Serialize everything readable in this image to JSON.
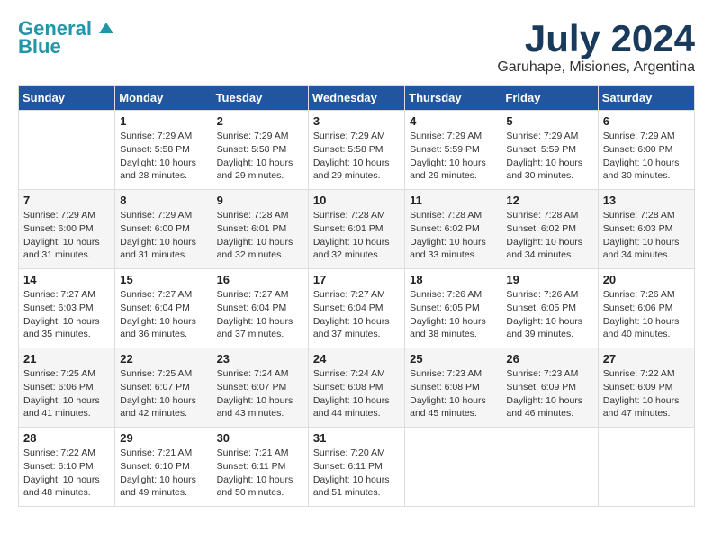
{
  "logo": {
    "line1": "General",
    "line2": "Blue"
  },
  "title": "July 2024",
  "location": "Garuhape, Misiones, Argentina",
  "days_of_week": [
    "Sunday",
    "Monday",
    "Tuesday",
    "Wednesday",
    "Thursday",
    "Friday",
    "Saturday"
  ],
  "weeks": [
    [
      {
        "day": "",
        "sunrise": "",
        "sunset": "",
        "daylight": ""
      },
      {
        "day": "1",
        "sunrise": "Sunrise: 7:29 AM",
        "sunset": "Sunset: 5:58 PM",
        "daylight": "Daylight: 10 hours and 28 minutes."
      },
      {
        "day": "2",
        "sunrise": "Sunrise: 7:29 AM",
        "sunset": "Sunset: 5:58 PM",
        "daylight": "Daylight: 10 hours and 29 minutes."
      },
      {
        "day": "3",
        "sunrise": "Sunrise: 7:29 AM",
        "sunset": "Sunset: 5:58 PM",
        "daylight": "Daylight: 10 hours and 29 minutes."
      },
      {
        "day": "4",
        "sunrise": "Sunrise: 7:29 AM",
        "sunset": "Sunset: 5:59 PM",
        "daylight": "Daylight: 10 hours and 29 minutes."
      },
      {
        "day": "5",
        "sunrise": "Sunrise: 7:29 AM",
        "sunset": "Sunset: 5:59 PM",
        "daylight": "Daylight: 10 hours and 30 minutes."
      },
      {
        "day": "6",
        "sunrise": "Sunrise: 7:29 AM",
        "sunset": "Sunset: 6:00 PM",
        "daylight": "Daylight: 10 hours and 30 minutes."
      }
    ],
    [
      {
        "day": "7",
        "sunrise": "Sunrise: 7:29 AM",
        "sunset": "Sunset: 6:00 PM",
        "daylight": "Daylight: 10 hours and 31 minutes."
      },
      {
        "day": "8",
        "sunrise": "Sunrise: 7:29 AM",
        "sunset": "Sunset: 6:00 PM",
        "daylight": "Daylight: 10 hours and 31 minutes."
      },
      {
        "day": "9",
        "sunrise": "Sunrise: 7:28 AM",
        "sunset": "Sunset: 6:01 PM",
        "daylight": "Daylight: 10 hours and 32 minutes."
      },
      {
        "day": "10",
        "sunrise": "Sunrise: 7:28 AM",
        "sunset": "Sunset: 6:01 PM",
        "daylight": "Daylight: 10 hours and 32 minutes."
      },
      {
        "day": "11",
        "sunrise": "Sunrise: 7:28 AM",
        "sunset": "Sunset: 6:02 PM",
        "daylight": "Daylight: 10 hours and 33 minutes."
      },
      {
        "day": "12",
        "sunrise": "Sunrise: 7:28 AM",
        "sunset": "Sunset: 6:02 PM",
        "daylight": "Daylight: 10 hours and 34 minutes."
      },
      {
        "day": "13",
        "sunrise": "Sunrise: 7:28 AM",
        "sunset": "Sunset: 6:03 PM",
        "daylight": "Daylight: 10 hours and 34 minutes."
      }
    ],
    [
      {
        "day": "14",
        "sunrise": "Sunrise: 7:27 AM",
        "sunset": "Sunset: 6:03 PM",
        "daylight": "Daylight: 10 hours and 35 minutes."
      },
      {
        "day": "15",
        "sunrise": "Sunrise: 7:27 AM",
        "sunset": "Sunset: 6:04 PM",
        "daylight": "Daylight: 10 hours and 36 minutes."
      },
      {
        "day": "16",
        "sunrise": "Sunrise: 7:27 AM",
        "sunset": "Sunset: 6:04 PM",
        "daylight": "Daylight: 10 hours and 37 minutes."
      },
      {
        "day": "17",
        "sunrise": "Sunrise: 7:27 AM",
        "sunset": "Sunset: 6:04 PM",
        "daylight": "Daylight: 10 hours and 37 minutes."
      },
      {
        "day": "18",
        "sunrise": "Sunrise: 7:26 AM",
        "sunset": "Sunset: 6:05 PM",
        "daylight": "Daylight: 10 hours and 38 minutes."
      },
      {
        "day": "19",
        "sunrise": "Sunrise: 7:26 AM",
        "sunset": "Sunset: 6:05 PM",
        "daylight": "Daylight: 10 hours and 39 minutes."
      },
      {
        "day": "20",
        "sunrise": "Sunrise: 7:26 AM",
        "sunset": "Sunset: 6:06 PM",
        "daylight": "Daylight: 10 hours and 40 minutes."
      }
    ],
    [
      {
        "day": "21",
        "sunrise": "Sunrise: 7:25 AM",
        "sunset": "Sunset: 6:06 PM",
        "daylight": "Daylight: 10 hours and 41 minutes."
      },
      {
        "day": "22",
        "sunrise": "Sunrise: 7:25 AM",
        "sunset": "Sunset: 6:07 PM",
        "daylight": "Daylight: 10 hours and 42 minutes."
      },
      {
        "day": "23",
        "sunrise": "Sunrise: 7:24 AM",
        "sunset": "Sunset: 6:07 PM",
        "daylight": "Daylight: 10 hours and 43 minutes."
      },
      {
        "day": "24",
        "sunrise": "Sunrise: 7:24 AM",
        "sunset": "Sunset: 6:08 PM",
        "daylight": "Daylight: 10 hours and 44 minutes."
      },
      {
        "day": "25",
        "sunrise": "Sunrise: 7:23 AM",
        "sunset": "Sunset: 6:08 PM",
        "daylight": "Daylight: 10 hours and 45 minutes."
      },
      {
        "day": "26",
        "sunrise": "Sunrise: 7:23 AM",
        "sunset": "Sunset: 6:09 PM",
        "daylight": "Daylight: 10 hours and 46 minutes."
      },
      {
        "day": "27",
        "sunrise": "Sunrise: 7:22 AM",
        "sunset": "Sunset: 6:09 PM",
        "daylight": "Daylight: 10 hours and 47 minutes."
      }
    ],
    [
      {
        "day": "28",
        "sunrise": "Sunrise: 7:22 AM",
        "sunset": "Sunset: 6:10 PM",
        "daylight": "Daylight: 10 hours and 48 minutes."
      },
      {
        "day": "29",
        "sunrise": "Sunrise: 7:21 AM",
        "sunset": "Sunset: 6:10 PM",
        "daylight": "Daylight: 10 hours and 49 minutes."
      },
      {
        "day": "30",
        "sunrise": "Sunrise: 7:21 AM",
        "sunset": "Sunset: 6:11 PM",
        "daylight": "Daylight: 10 hours and 50 minutes."
      },
      {
        "day": "31",
        "sunrise": "Sunrise: 7:20 AM",
        "sunset": "Sunset: 6:11 PM",
        "daylight": "Daylight: 10 hours and 51 minutes."
      },
      {
        "day": "",
        "sunrise": "",
        "sunset": "",
        "daylight": ""
      },
      {
        "day": "",
        "sunrise": "",
        "sunset": "",
        "daylight": ""
      },
      {
        "day": "",
        "sunrise": "",
        "sunset": "",
        "daylight": ""
      }
    ]
  ]
}
